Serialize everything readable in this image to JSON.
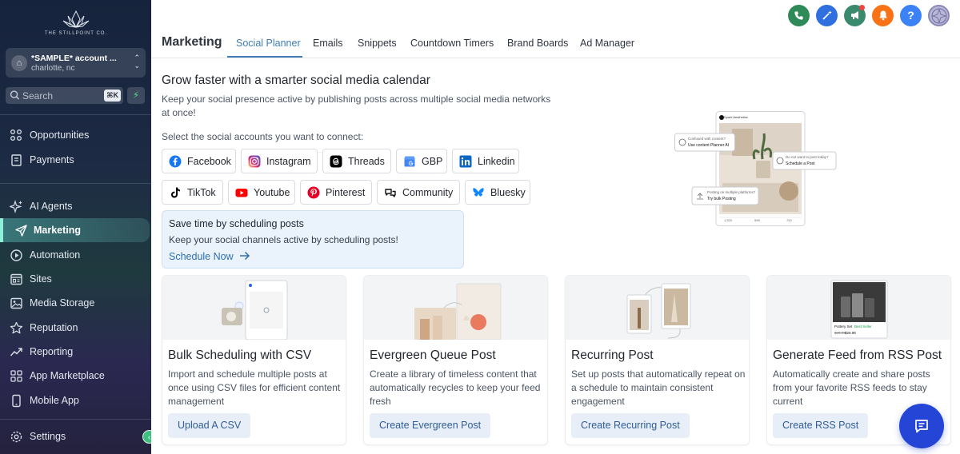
{
  "sidebar": {
    "logo_text": "THE STILLPOINT CO.",
    "account": {
      "name": "*SAMPLE* account ...",
      "location": "charlotte, nc"
    },
    "search": {
      "placeholder": "Search",
      "shortcut": "⌘K"
    },
    "items": [
      {
        "label": "Opportunities",
        "icon": "opportunities-icon"
      },
      {
        "label": "Payments",
        "icon": "payments-icon"
      },
      {
        "label": "AI Agents",
        "icon": "ai-sparkle-icon"
      },
      {
        "label": "Marketing",
        "icon": "paper-plane-icon",
        "active": true
      },
      {
        "label": "Automation",
        "icon": "automation-icon"
      },
      {
        "label": "Sites",
        "icon": "sites-icon"
      },
      {
        "label": "Media Storage",
        "icon": "image-icon"
      },
      {
        "label": "Reputation",
        "icon": "star-icon"
      },
      {
        "label": "Reporting",
        "icon": "trend-icon"
      },
      {
        "label": "App Marketplace",
        "icon": "grid-icon"
      },
      {
        "label": "Mobile App",
        "icon": "phone-icon"
      }
    ],
    "settings_label": "Settings"
  },
  "header": {
    "title": "Marketing",
    "tabs": [
      {
        "label": "Social Planner",
        "active": true
      },
      {
        "label": "Emails"
      },
      {
        "label": "Snippets"
      },
      {
        "label": "Countdown Timers"
      },
      {
        "label": "Brand Boards"
      },
      {
        "label": "Ad Manager"
      }
    ],
    "top_icons": [
      {
        "name": "call-icon",
        "color": "#2e8b57"
      },
      {
        "name": "magic-icon",
        "color": "#2f6fe0"
      },
      {
        "name": "megaphone-icon",
        "color": "#3a8a6e"
      },
      {
        "name": "bell-icon",
        "color": "#f97316"
      },
      {
        "name": "help-icon",
        "color": "#3b82f6"
      }
    ]
  },
  "hero": {
    "title": "Grow faster with a smarter social media calendar",
    "description": "Keep your social presence active by publishing posts across multiple social media networks at once!",
    "connect_label": "Select the social accounts you want to connect:"
  },
  "social_accounts": [
    {
      "label": "Facebook",
      "icon": "facebook-icon",
      "color": "#1877f2"
    },
    {
      "label": "Instagram",
      "icon": "instagram-icon",
      "color": "#d62976"
    },
    {
      "label": "Threads",
      "icon": "threads-icon",
      "color": "#000000"
    },
    {
      "label": "GBP",
      "icon": "google-business-icon",
      "color": "#4285f4"
    },
    {
      "label": "Linkedin",
      "icon": "linkedin-icon",
      "color": "#0a66c2"
    },
    {
      "label": "TikTok",
      "icon": "tiktok-icon",
      "color": "#000000"
    },
    {
      "label": "Youtube",
      "icon": "youtube-icon",
      "color": "#ff0000"
    },
    {
      "label": "Pinterest",
      "icon": "pinterest-icon",
      "color": "#e60023"
    },
    {
      "label": "Community",
      "icon": "community-icon",
      "color": "#111111"
    },
    {
      "label": "Bluesky",
      "icon": "bluesky-icon",
      "color": "#1185fe"
    }
  ],
  "promo": {
    "title": "Save time by scheduling posts",
    "description": "Keep your social channels active by scheduling posts!",
    "link": "Schedule Now"
  },
  "illustration": {
    "account_label": "Spark Aesthetics",
    "bubbles": [
      {
        "title": "Confused with content?",
        "action": "Use content Planner AI"
      },
      {
        "title": "Do not want to post today?",
        "action": "Schedule a Post"
      },
      {
        "title": "Posting on multiple platforms?",
        "action": "Try bulk Posting"
      }
    ],
    "stats": [
      "1,520",
      "598",
      "720"
    ]
  },
  "cards": [
    {
      "title": "Bulk Scheduling with CSV",
      "description": "Import and schedule multiple posts at once using CSV files for efficient content management",
      "button": "Upload A CSV"
    },
    {
      "title": "Evergreen Queue Post",
      "description": "Create a library of timeless content that automatically recycles to keep your feed fresh",
      "button": "Create Evergreen Post"
    },
    {
      "title": "Recurring Post",
      "description": "Set up posts that automatically repeat on a schedule to maintain consistent engagement",
      "button": "Create Recurring Post"
    },
    {
      "title": "Generate Feed from RSS Post",
      "description": "Automatically create and share posts from your favorite RSS feeds to stay current",
      "button": "Create RSS Post",
      "image_labels": {
        "product": "Pottery Set",
        "badge": "Best Seller",
        "old_price": "$39.99",
        "price": "$29.99"
      }
    }
  ]
}
